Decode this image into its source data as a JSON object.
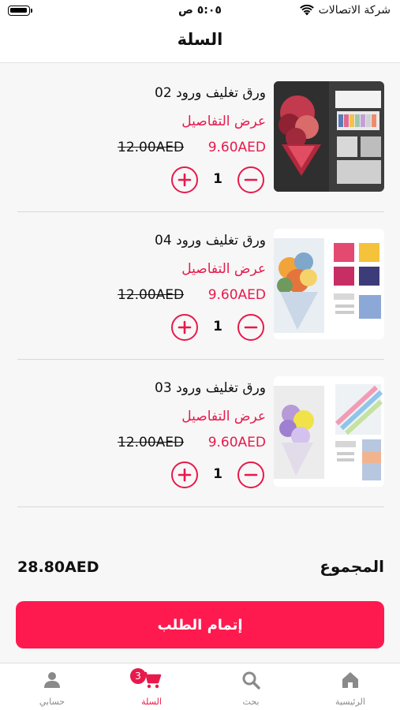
{
  "status_bar": {
    "carrier": "شركة الاتصالات",
    "time": "٥:٠٥ ص"
  },
  "header": {
    "title": "السلة"
  },
  "cart": {
    "items": [
      {
        "name": "ورق تغليف ورود 02",
        "details_label": "عرض التفاصيل",
        "price": "9.60AED",
        "old_price": "12.00AED",
        "quantity": "1",
        "image": "floral-wrapping-paper-02"
      },
      {
        "name": "ورق تغليف ورود 04",
        "details_label": "عرض التفاصيل",
        "price": "9.60AED",
        "old_price": "12.00AED",
        "quantity": "1",
        "image": "floral-wrapping-paper-04"
      },
      {
        "name": "ورق تغليف ورود 03",
        "details_label": "عرض التفاصيل",
        "price": "9.60AED",
        "old_price": "12.00AED",
        "quantity": "1",
        "image": "floral-wrapping-paper-03"
      }
    ]
  },
  "summary": {
    "total_label": "المجموع",
    "total_value": "28.80AED"
  },
  "checkout": {
    "label": "إتمام الطلب"
  },
  "tabbar": {
    "home": {
      "label": "الرئيسية",
      "icon": "home-icon"
    },
    "search": {
      "label": "بحث",
      "icon": "search-icon"
    },
    "cart": {
      "label": "السلة",
      "icon": "cart-icon",
      "badge": "3"
    },
    "account": {
      "label": "حسابي",
      "icon": "person-icon"
    }
  },
  "colors": {
    "accent": "#e8194b",
    "button": "#fe1a4f",
    "inactive": "#8a8a8a"
  }
}
